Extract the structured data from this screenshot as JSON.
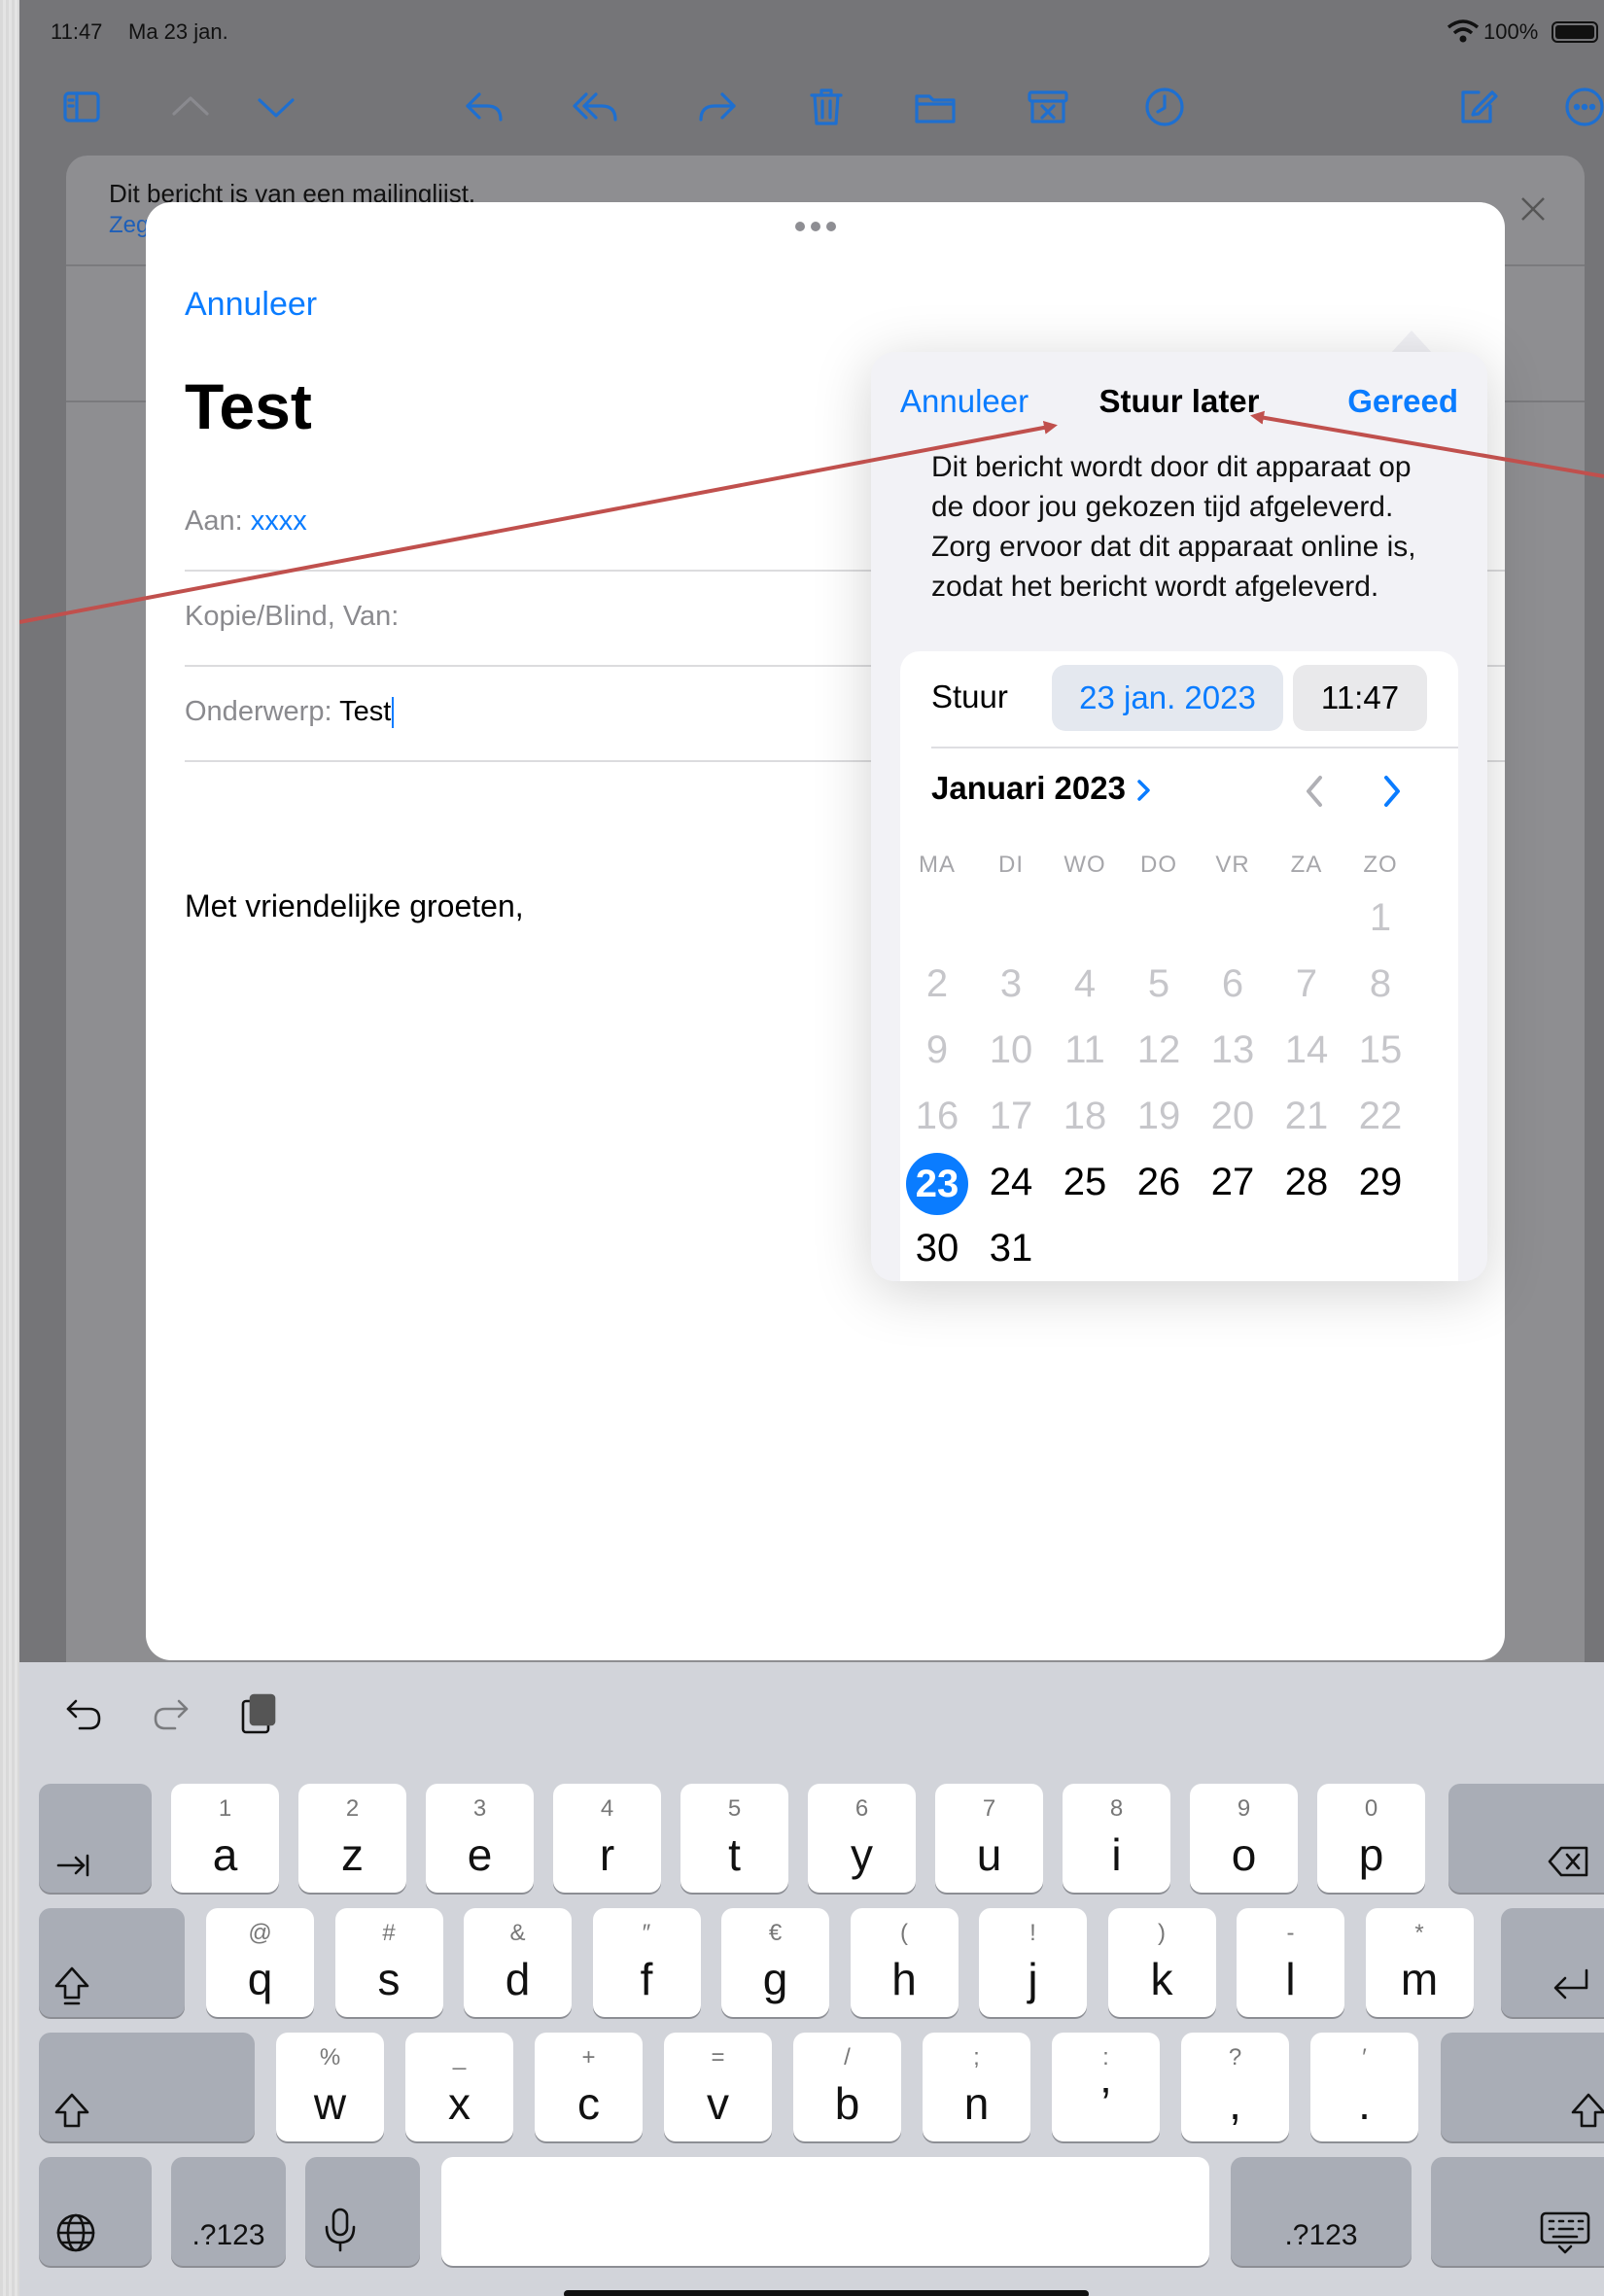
{
  "status_bar": {
    "time": "11:47",
    "date": "Ma 23 jan.",
    "battery": "100%"
  },
  "notice": {
    "text": "Dit bericht is van een mailinglijst.",
    "link_partial": "Zeg"
  },
  "compose": {
    "cancel": "Annuleer",
    "subject_title": "Test",
    "to_label": "Aan:",
    "to_value": "xxxx",
    "cc_label": "Kopie/Blind, Van:",
    "subject_label": "Onderwerp:",
    "subject_value": "Test",
    "body": "Met vriendelijke groeten,"
  },
  "send_later": {
    "cancel": "Annuleer",
    "title": "Stuur later",
    "done": "Gereed",
    "description": "Dit bericht wordt door dit apparaat op de door jou gekozen tijd afgeleverd. Zorg ervoor dat dit apparaat online is, zodat het bericht wordt afgeleverd.",
    "send_label": "Stuur",
    "date": "23 jan. 2023",
    "time": "11:47",
    "month": "Januari 2023",
    "weekdays": [
      "MA",
      "DI",
      "WO",
      "DO",
      "VR",
      "ZA",
      "ZO"
    ],
    "selected_day": "23"
  },
  "keyboard": {
    "row1": [
      {
        "sub": "1",
        "main": "a"
      },
      {
        "sub": "2",
        "main": "z"
      },
      {
        "sub": "3",
        "main": "e"
      },
      {
        "sub": "4",
        "main": "r"
      },
      {
        "sub": "5",
        "main": "t"
      },
      {
        "sub": "6",
        "main": "y"
      },
      {
        "sub": "7",
        "main": "u"
      },
      {
        "sub": "8",
        "main": "i"
      },
      {
        "sub": "9",
        "main": "o"
      },
      {
        "sub": "0",
        "main": "p"
      }
    ],
    "row2": [
      {
        "sub": "@",
        "main": "q"
      },
      {
        "sub": "#",
        "main": "s"
      },
      {
        "sub": "&",
        "main": "d"
      },
      {
        "sub": "″",
        "main": "f"
      },
      {
        "sub": "€",
        "main": "g"
      },
      {
        "sub": "(",
        "main": "h"
      },
      {
        "sub": "!",
        "main": "j"
      },
      {
        "sub": ")",
        "main": "k"
      },
      {
        "sub": "-",
        "main": "l"
      },
      {
        "sub": "*",
        "main": "m"
      }
    ],
    "row3": [
      {
        "sub": "%",
        "main": "w"
      },
      {
        "sub": "_",
        "main": "x"
      },
      {
        "sub": "+",
        "main": "c"
      },
      {
        "sub": "=",
        "main": "v"
      },
      {
        "sub": "/",
        "main": "b"
      },
      {
        "sub": ";",
        "main": "n"
      },
      {
        "sub": ":",
        "main": "’"
      },
      {
        "sub": "?",
        "main": ","
      },
      {
        "sub": "′",
        "main": "."
      }
    ],
    "numbers_label": ".?123"
  }
}
